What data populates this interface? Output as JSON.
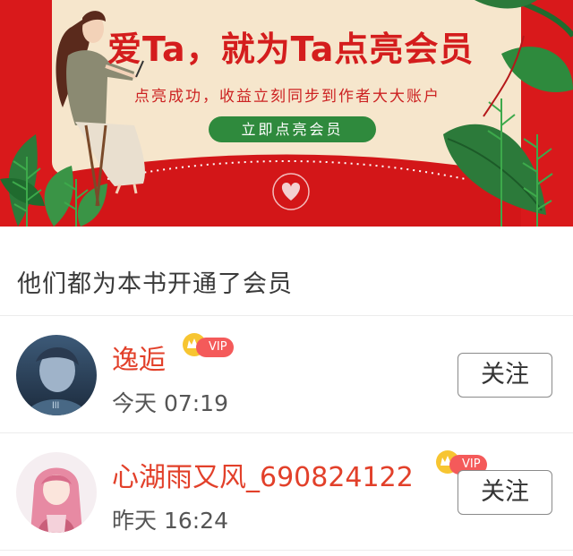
{
  "banner": {
    "title": "爱Ta，就为Ta点亮会员",
    "subtitle": "点亮成功，收益立刻同步到作者大大账户",
    "button_label": "立即点亮会员"
  },
  "section": {
    "title": "他们都为本书开通了会员"
  },
  "members": [
    {
      "name": "逸逅",
      "badge": "VIP",
      "time": "今天 07:19",
      "follow_label": "关注"
    },
    {
      "name": "心湖雨又风_690824122",
      "badge": "VIP",
      "time": "昨天 16:24",
      "follow_label": "关注"
    }
  ],
  "colors": {
    "banner_red": "#d9191b",
    "banner_cream": "#f6e6cc",
    "button_green": "#2f8a3d",
    "name_red": "#e2402a",
    "vip_pink": "#f45a5a"
  }
}
